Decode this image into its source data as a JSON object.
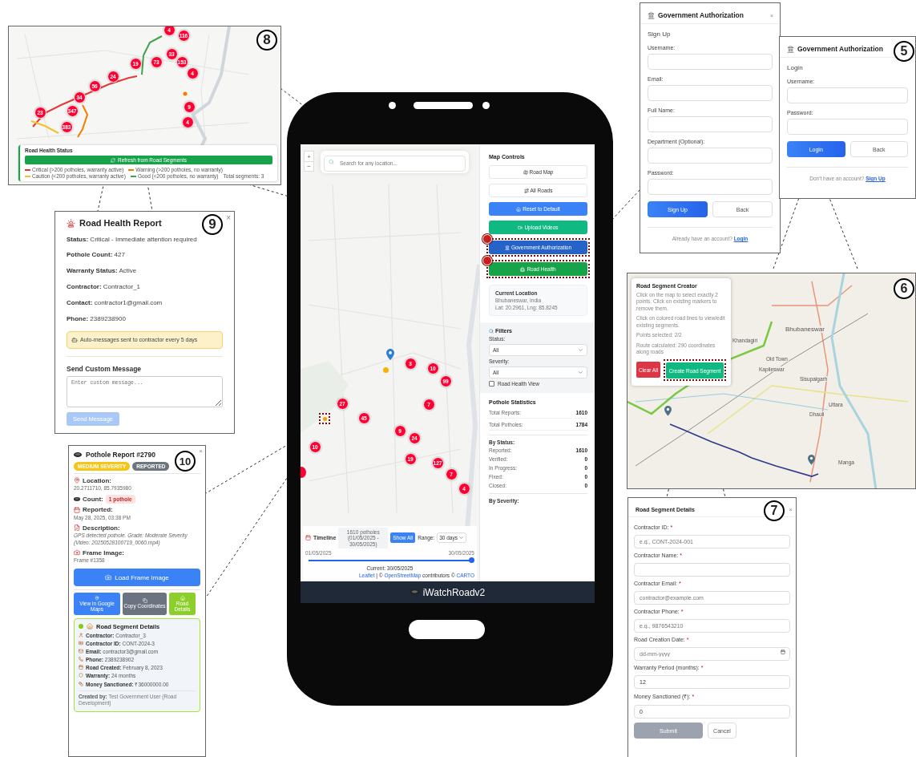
{
  "road_health_map": {
    "callout": "8",
    "clusters": [
      "4",
      "116",
      "19",
      "73",
      "33",
      "153",
      "24",
      "4",
      "56",
      "34",
      "23",
      "347",
      "9",
      "383",
      "4"
    ],
    "legend_title": "Road Health Status",
    "refresh_button": "Refresh from Road Segments",
    "legend": [
      {
        "label": "Critical (>200 potholes, warranty active)",
        "color": "#e53935"
      },
      {
        "label": "Warning (>200 potholes, no warranty)",
        "color": "#f57c00"
      },
      {
        "label": "Caution (<200 potholes, warranty active)",
        "color": "#f5c02d"
      },
      {
        "label": "Good (<200 potholes, no warranty)",
        "color": "#3fa34d"
      }
    ],
    "total_segments": "Total segments: 3"
  },
  "road_health_report": {
    "callout": "9",
    "close": "×",
    "title": "Road Health Report",
    "fields": [
      {
        "label": "Status:",
        "value": "Critical - Immediate attention required"
      },
      {
        "label": "Pothole Count:",
        "value": "427"
      },
      {
        "label": "Warranty Status:",
        "value": "Active"
      },
      {
        "label": "Contractor:",
        "value": "Contractor_1"
      },
      {
        "label": "Contact:",
        "value": "contractor1@gmail.com"
      },
      {
        "label": "Phone:",
        "value": "2389238900"
      }
    ],
    "notice": "Auto-messages sent to contractor every 5 days",
    "section_title": "Send Custom Message",
    "message_placeholder": "Enter custom message...",
    "send_button": {
      "label": "Send Message",
      "disabled": true
    }
  },
  "pothole_report": {
    "callout": "10",
    "close": "×",
    "title": "Pothole Report #2790",
    "badges": [
      {
        "label": "MEDIUM SEVERITY",
        "color": "#f5c518"
      },
      {
        "label": "REPORTED",
        "color": "#6c757d"
      }
    ],
    "sections": [
      {
        "kind": "text",
        "label": "Location:",
        "value": "20.2711710, 85.7935980"
      },
      {
        "kind": "badge",
        "label": "Count:",
        "value": "1 pothole"
      },
      {
        "kind": "text",
        "label": "Reported:",
        "value": "May 28, 2025, 03:38 PM"
      },
      {
        "kind": "italic",
        "label": "Description:",
        "value": "GPS detected pothole. Grade: Moderate Severity (Video: 20250528100719_0060.mp4)"
      },
      {
        "kind": "text",
        "label": "Frame Image:",
        "value": "Frame #1358"
      }
    ],
    "load_button": "Load Frame Image",
    "actions": [
      {
        "label": "View in Google Maps",
        "color": "#3b82f6"
      },
      {
        "label": "Copy Coordinates",
        "color": "#6b7280"
      },
      {
        "label": "Road Details",
        "color": "#8ccf2a"
      }
    ],
    "segment": {
      "title": "Road Segment Details",
      "color": "#84cc16",
      "rows": [
        {
          "label": "Contractor:",
          "value": "Contractor_3"
        },
        {
          "label": "Contractor ID:",
          "value": "CONT-2024-3"
        },
        {
          "label": "Email:",
          "value": "contractor3@gmail.com"
        },
        {
          "label": "Phone:",
          "value": "2389238902"
        },
        {
          "label": "Road Created:",
          "value": "February 8, 2023"
        },
        {
          "label": "Warranty:",
          "value": "24 months"
        },
        {
          "label": "Money Sanctioned:",
          "value": "₹36000000.00"
        }
      ],
      "created_by_label": "Created by:",
      "created_by": "Test Government User (Road Development)"
    }
  },
  "phone_app": {
    "search_placeholder": "Search for any location...",
    "zoom_in": "+",
    "zoom_out": "−",
    "clusters": [
      "3",
      "10",
      "99",
      "27",
      "45",
      "7",
      "9",
      "24",
      "10",
      "19",
      "127",
      "7",
      "4"
    ],
    "selected_marker_highlighted": true,
    "timeline": {
      "title": "Timeline",
      "summary": "1610 potholes (01/05/2025 - 30/05/2025)",
      "show_all": "Show All",
      "range_label": "Range:",
      "range_value": "30 days",
      "start": "01/05/2025",
      "end": "30/05/2025",
      "level": 1,
      "current": "Current: 30/05/2025"
    },
    "attribution": [
      {
        "text": "Leaflet",
        "link": true
      },
      {
        "text": " | © ",
        "link": false
      },
      {
        "text": "OpenStreetMap",
        "link": true
      },
      {
        "text": " contributors © ",
        "link": false
      },
      {
        "text": "CARTO",
        "link": true
      }
    ],
    "sidebar": {
      "title": "Map Controls",
      "buttons": [
        {
          "label": "Road Map",
          "badge": false,
          "highlighted": false
        },
        {
          "label": "All Roads",
          "badge": false,
          "highlighted": false
        },
        {
          "label": "Reset to Default",
          "badge": false,
          "highlighted": false
        },
        {
          "label": "Upload Videos",
          "badge": false,
          "highlighted": false
        },
        {
          "label": "Government Authorization",
          "badge": true,
          "highlighted": true
        },
        {
          "label": "Road Health",
          "badge": true,
          "highlighted": true
        }
      ],
      "location": {
        "title": "Current Location",
        "place": "Bhubaneswar, India",
        "coords": "Lat: 20.2961, Lng: 85.8245"
      },
      "filters": {
        "title": "Filters",
        "selects": [
          {
            "label": "Status:",
            "value": "All"
          },
          {
            "label": "Severity:",
            "value": "All"
          }
        ],
        "checkbox": {
          "label": "Road Health View",
          "checked": false
        }
      },
      "stats": {
        "title": "Pothole Statistics",
        "totals": [
          {
            "label": "Total Reports:",
            "value": "1610"
          },
          {
            "label": "Total Potholes:",
            "value": "1784"
          }
        ],
        "by_status_title": "By Status:",
        "by_status": [
          {
            "label": "Reported:",
            "value": "1610"
          },
          {
            "label": "Verified:",
            "value": "0"
          },
          {
            "label": "In Progress:",
            "value": "0"
          },
          {
            "label": "Fixed:",
            "value": "0"
          },
          {
            "label": "Closed:",
            "value": "0"
          }
        ],
        "by_severity_title": "By Severity:"
      }
    },
    "app_name": "iWatchRoadv2"
  },
  "signup_dialog": {
    "title": "Government Authorization",
    "close": "×",
    "heading": "Sign Up",
    "fields": [
      "Username:",
      "Email:",
      "Full Name:",
      "Department (Optional):",
      "Password:"
    ],
    "primary": "Sign Up",
    "secondary": "Back",
    "footer": "Already have an account?",
    "footer_link": "Login"
  },
  "login_dialog": {
    "callout": "5",
    "title": "Government Authorization",
    "heading": "Login",
    "fields": [
      "Username:",
      "Password:"
    ],
    "primary": "Login",
    "secondary": "Back",
    "footer": "Don't have an account?",
    "footer_link": "Sign Up"
  },
  "segment_creator": {
    "callout": "6",
    "title": "Road Segment Creator",
    "notes": [
      "Click on the map to select exactly 2 points. Click on existing markers to remove them.",
      "Click on colored road lines to view/edit existing segments.",
      "Points selected: 2/2",
      "Route calculated: 290 coordinates along roads"
    ],
    "clear_button": "Clear All",
    "create_button": "Create Road Segment",
    "create_highlighted": true,
    "place_labels": [
      "Bhubaneswar",
      "Old Town",
      "Kapileswar",
      "Sisupalgarh",
      "Khandagiri",
      "Uttara",
      "Dhauli",
      "Manga"
    ]
  },
  "segment_details": {
    "callout": "7",
    "title": "Road Segment Details",
    "close": "×",
    "required_mark": "*",
    "fields": [
      {
        "label": "Contractor ID:",
        "required": true,
        "kind": "text",
        "placeholder": "e.g., CONT-2024-001"
      },
      {
        "label": "Contractor Name:",
        "required": true,
        "kind": "text"
      },
      {
        "label": "Contractor Email:",
        "required": true,
        "kind": "text",
        "placeholder": "contractor@example.com"
      },
      {
        "label": "Contractor Phone:",
        "required": true,
        "kind": "text",
        "placeholder": "e.g., 9876543210"
      },
      {
        "label": "Road Creation Date:",
        "required": true,
        "kind": "date",
        "placeholder": "dd-mm-yyyy"
      },
      {
        "label": "Warranty Period (months):",
        "required": true,
        "kind": "text",
        "value": "12"
      },
      {
        "label": "Money Sanctioned (₹):",
        "required": true,
        "kind": "text",
        "value": "0"
      }
    ],
    "submit": {
      "label": "Submit",
      "disabled": true
    },
    "cancel": "Cancel"
  }
}
